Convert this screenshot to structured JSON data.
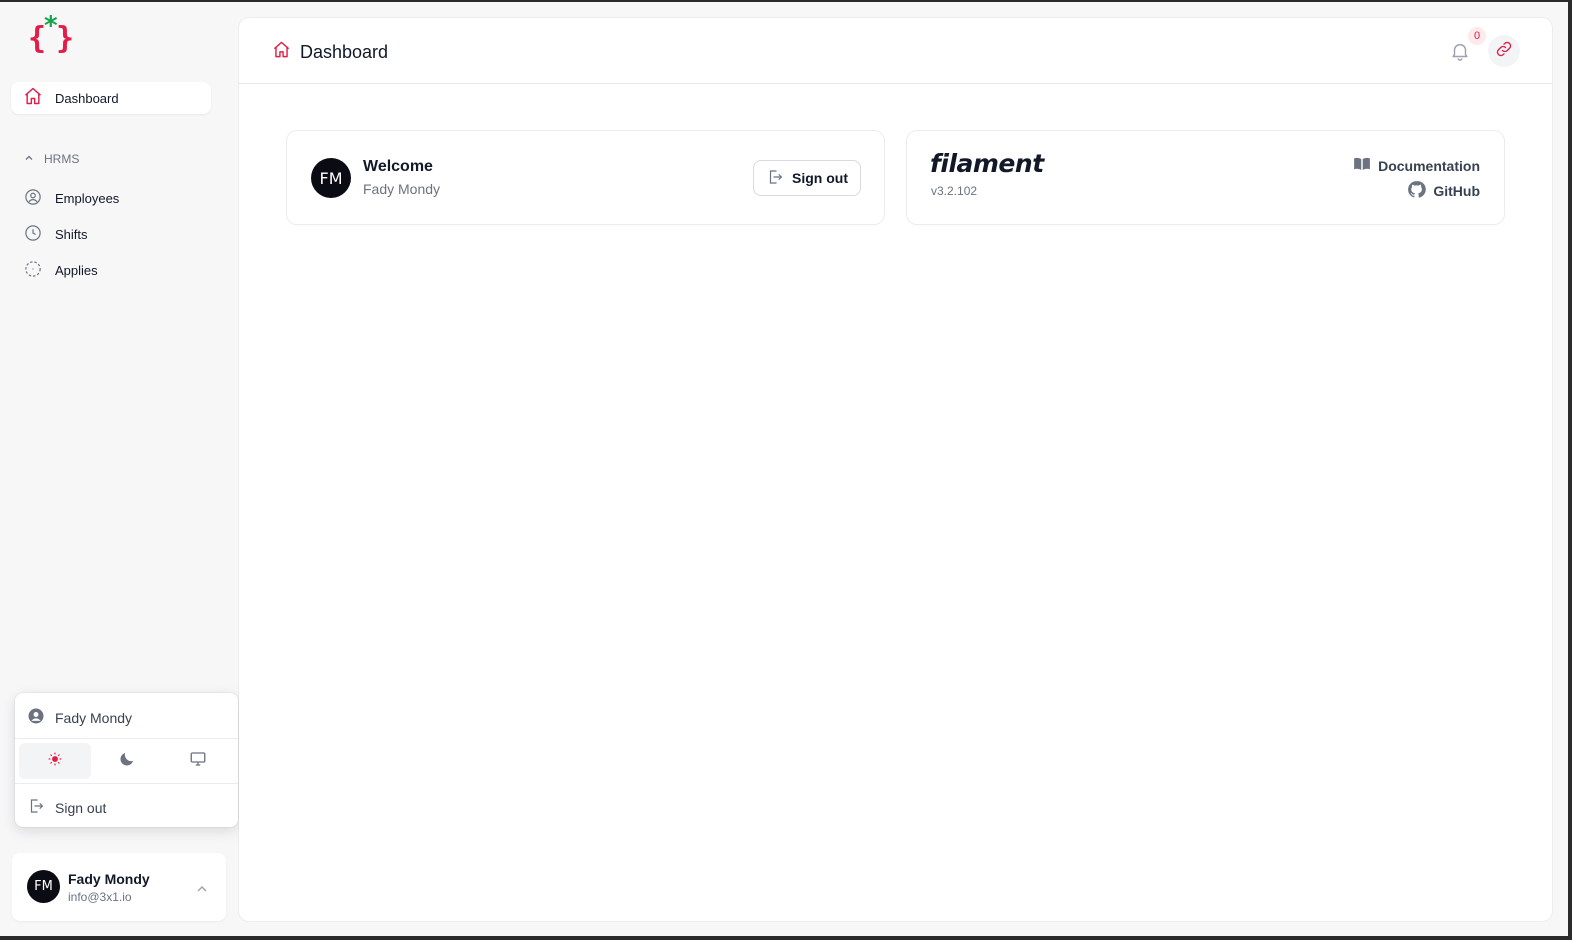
{
  "sidebar": {
    "active_item": {
      "label": "Dashboard",
      "icon": "home-icon"
    },
    "group": {
      "label": "HRMS",
      "icon": "chevron-up-icon"
    },
    "items": [
      {
        "label": "Employees",
        "icon": "user-circle-icon"
      },
      {
        "label": "Shifts",
        "icon": "clock-icon"
      },
      {
        "label": "Applies",
        "icon": "dashed-circle-icon"
      }
    ]
  },
  "user_menu": {
    "user_name": "Fady Mondy",
    "theme_options": [
      "light",
      "dark",
      "system"
    ],
    "selected_theme": "light",
    "signout_label": "Sign out"
  },
  "profile": {
    "initials": "FM",
    "name": "Fady Mondy",
    "email": "info@3x1.io"
  },
  "header": {
    "title": "Dashboard",
    "notification_count": "0"
  },
  "welcome_card": {
    "initials": "FM",
    "title": "Welcome",
    "name": "Fady Mondy",
    "signout_label": "Sign out"
  },
  "info_card": {
    "brand": "filament",
    "version": "v3.2.102",
    "documentation_label": "Documentation",
    "github_label": "GitHub"
  },
  "colors": {
    "accent": "#e11d48",
    "logo_green": "#16a34a",
    "icon_gray": "#6b7280"
  }
}
